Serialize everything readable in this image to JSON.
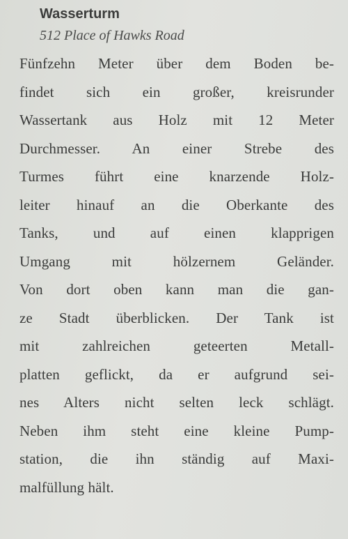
{
  "entry": {
    "title": "Wasserturm",
    "address": "512 Place of Hawks Road",
    "lines": [
      "Fünfzehn Meter über dem Boden be-",
      "findet sich ein großer, kreisrunder",
      "Wassertank aus Holz mit 12 Meter",
      "Durchmesser. An einer Strebe des",
      "Turmes führt eine knarzende Holz-",
      "leiter hinauf an die Oberkante des",
      "Tanks, und auf einen klapprigen",
      "Umgang mit hölzernem Geländer.",
      "Von dort oben kann man die gan-",
      "ze Stadt überblicken. Der Tank ist",
      "mit zahlreichen geteerten Metall-",
      "platten geflickt, da er aufgrund sei-",
      "nes Alters nicht selten leck schlägt.",
      "Neben ihm steht eine kleine Pump-",
      "station, die ihn ständig auf Maxi-",
      "malfüllung hält."
    ]
  }
}
